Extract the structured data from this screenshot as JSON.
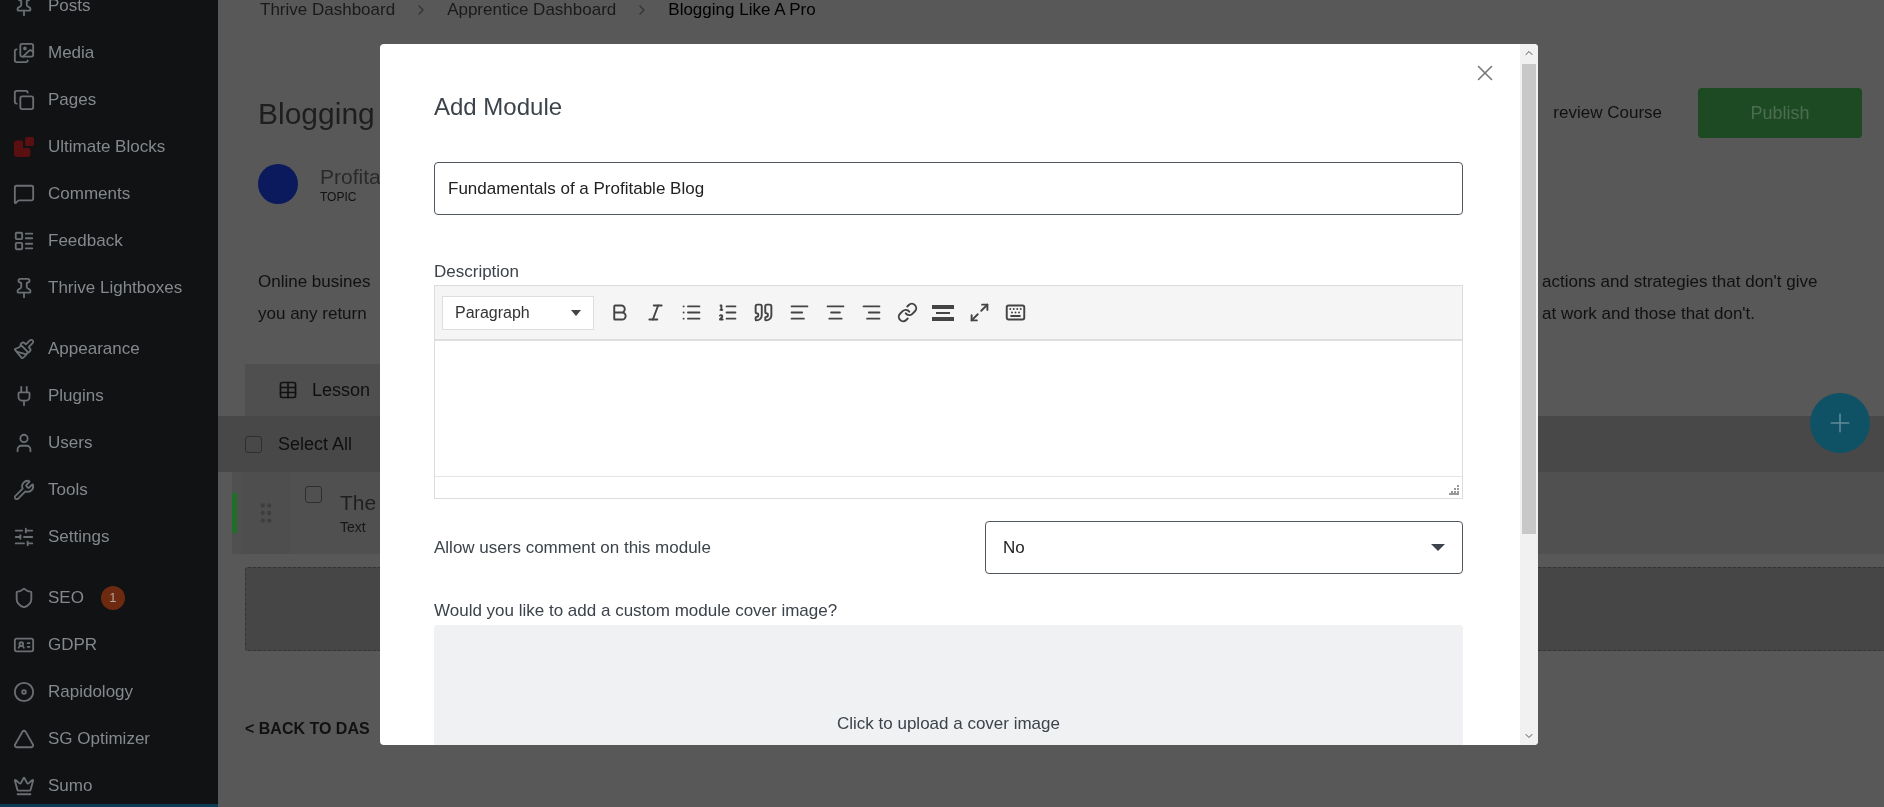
{
  "sidebar": {
    "groups": [
      {
        "items": [
          {
            "label": "Posts"
          },
          {
            "label": "Media"
          },
          {
            "label": "Pages"
          },
          {
            "label": "Ultimate Blocks"
          },
          {
            "label": "Comments"
          },
          {
            "label": "Feedback"
          },
          {
            "label": "Thrive Lightboxes"
          }
        ]
      },
      {
        "items": [
          {
            "label": "Appearance"
          },
          {
            "label": "Plugins"
          },
          {
            "label": "Users"
          },
          {
            "label": "Tools"
          },
          {
            "label": "Settings"
          }
        ]
      },
      {
        "items": [
          {
            "label": "SEO",
            "badge": "1"
          },
          {
            "label": "GDPR"
          },
          {
            "label": "Rapidology"
          },
          {
            "label": "SG Optimizer"
          },
          {
            "label": "Sumo"
          }
        ]
      }
    ]
  },
  "breadcrumbs": [
    {
      "label": "Thrive Dashboard",
      "current": false
    },
    {
      "label": "Apprentice Dashboard",
      "current": false
    },
    {
      "label": "Blogging Like A Pro",
      "current": true
    }
  ],
  "header": {
    "title": "Blogging",
    "preview_link": "review Course",
    "publish_button": "Publish"
  },
  "topic": {
    "name": "Profita",
    "type": "TOPIC"
  },
  "description": {
    "left_lines": [
      "Online busines",
      "you any return"
    ],
    "right_lines": [
      "actions and strategies that don't give",
      "at work and those that don't."
    ]
  },
  "lessons_tab": {
    "label": "Lesson"
  },
  "select_all": {
    "label": "Select All",
    "checked": false
  },
  "lessons": [
    {
      "title": "The",
      "subtitle": "Text",
      "checked": false
    }
  ],
  "back_link": "< BACK TO DAS",
  "modal": {
    "title": "Add Module",
    "name_value": "Fundamentals of a Profitable Blog",
    "description_label": "Description",
    "editor": {
      "format": "Paragraph"
    },
    "comment_label": "Allow users comment on this module",
    "comment_value": "No",
    "cover_label": "Would you like to add a custom module cover image?",
    "upload_text": "Click to upload a cover image"
  }
}
